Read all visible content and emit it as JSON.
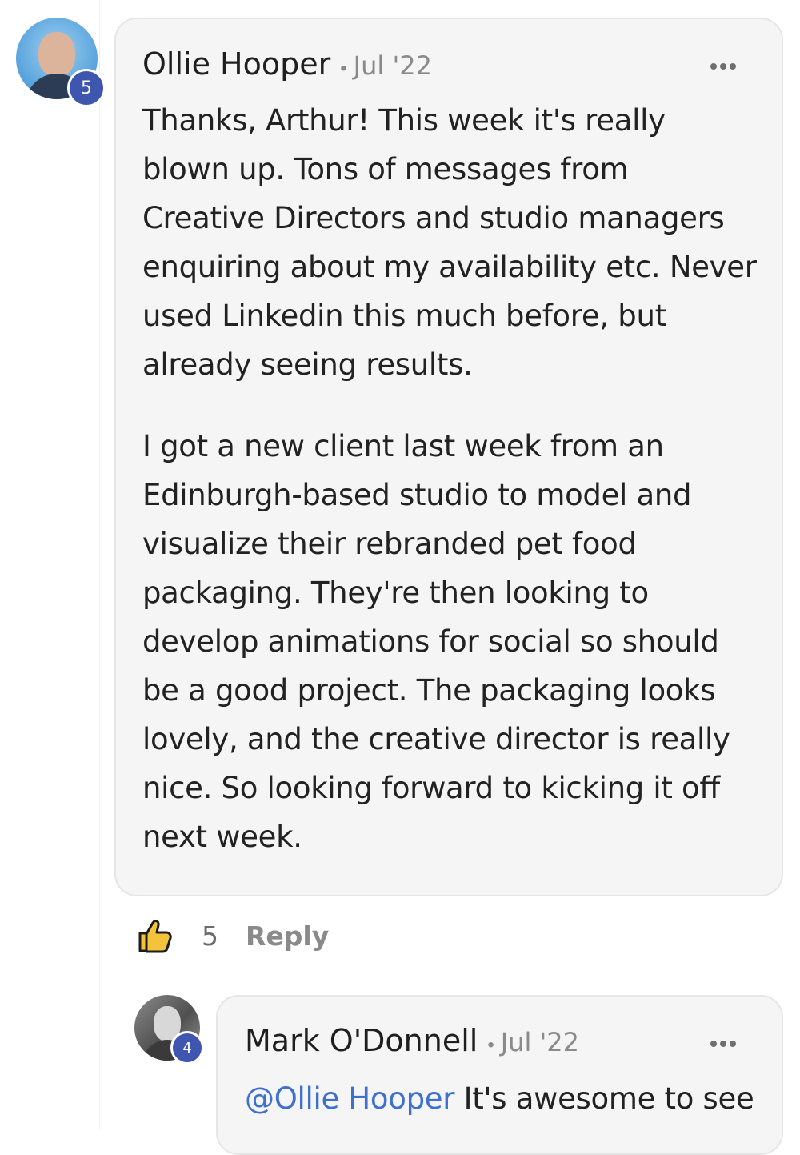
{
  "comment": {
    "author": "Ollie Hooper",
    "date": "Jul '22",
    "badge": "5",
    "paragraphs": [
      "Thanks, Arthur! This week it's really blown up. Tons of messages from Creative Directors and studio managers enquiring about my availability etc. Never used Linkedin this much before, but already seeing results.",
      "I got a new client last week from an Edinburgh-based studio to model and visualize their rebranded pet food packaging. They're then looking to develop animations for social so should be a good project. The packaging looks lovely, and the creative director is really nice. So looking forward to kicking it off next week."
    ],
    "like_count": "5",
    "reply_label": "Reply",
    "dot": "•"
  },
  "reply": {
    "author": "Mark O'Donnell",
    "date": "Jul '22",
    "badge": "4",
    "mention": "@Ollie Hooper",
    "text": " It's awesome to see",
    "dot": "•"
  },
  "colors": {
    "badge": "#3e56b0",
    "mention": "#3f6fcf",
    "like_icon": "#f5c33b"
  },
  "icons": {
    "more": "more-horizontal-icon",
    "like": "thumbs-up-icon"
  }
}
